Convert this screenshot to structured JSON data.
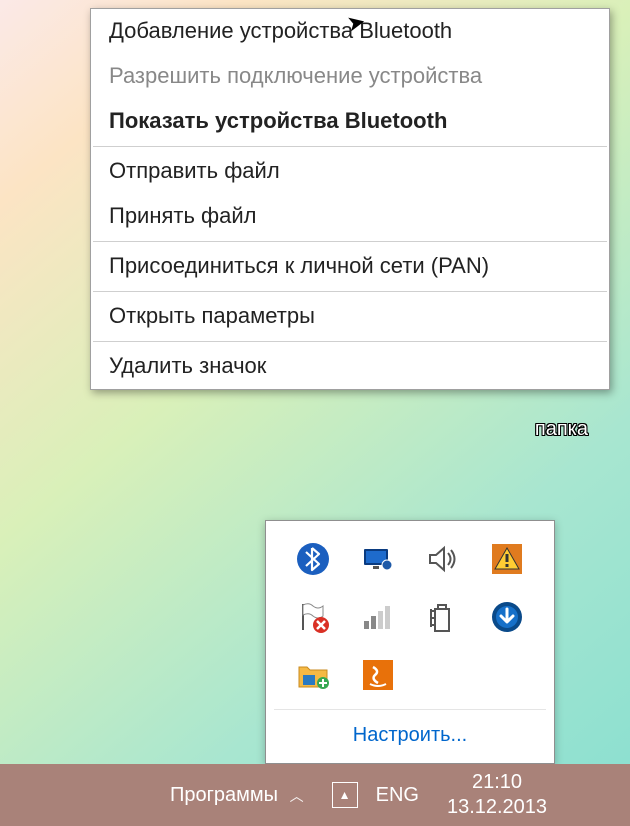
{
  "context_menu": {
    "items": [
      {
        "label": "Добавление устройства Bluetooth",
        "kind": "item"
      },
      {
        "label": "Разрешить подключение устройства",
        "kind": "disabled"
      },
      {
        "label": "Показать устройства Bluetooth",
        "kind": "bold"
      },
      {
        "kind": "sep"
      },
      {
        "label": "Отправить файл",
        "kind": "item"
      },
      {
        "label": "Принять файл",
        "kind": "item"
      },
      {
        "kind": "sep"
      },
      {
        "label": "Присоединиться к личной сети (PAN)",
        "kind": "item"
      },
      {
        "kind": "sep"
      },
      {
        "label": "Открыть параметры",
        "kind": "item"
      },
      {
        "kind": "sep"
      },
      {
        "label": "Удалить значок",
        "kind": "item"
      }
    ]
  },
  "tray": {
    "customize": "Настроить...",
    "icons": [
      {
        "name": "bluetooth-icon"
      },
      {
        "name": "display-icon"
      },
      {
        "name": "volume-icon"
      },
      {
        "name": "warning-icon"
      },
      {
        "name": "flag-error-icon"
      },
      {
        "name": "signal-icon"
      },
      {
        "name": "battery-icon"
      },
      {
        "name": "download-icon"
      },
      {
        "name": "folder-icon"
      },
      {
        "name": "java-icon"
      }
    ]
  },
  "taskbar": {
    "programs": "Программы",
    "lang": "ENG",
    "time": "21:10",
    "date": "13.12.2013"
  },
  "desktop": {
    "folder_label": "папка"
  }
}
